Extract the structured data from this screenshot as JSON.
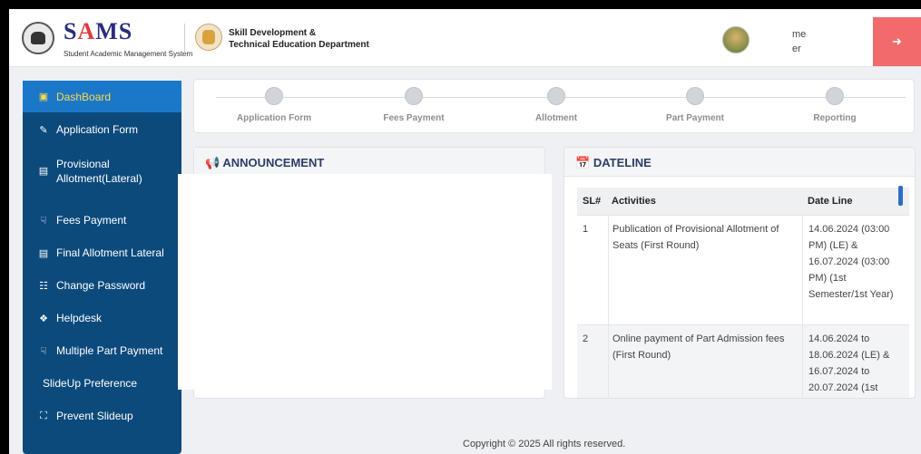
{
  "header": {
    "brand_title_s": "S",
    "brand_title_a": "A",
    "brand_title_ms": "MS",
    "brand_subtitle": "Student Academic Management System",
    "dept_line1": "Skill Development &",
    "dept_line2": "Technical Education Department",
    "user_name": "me",
    "user_role": "er"
  },
  "sidebar": {
    "items": [
      {
        "label": "DashBoard",
        "icon": "dashboard-icon"
      },
      {
        "label": "Application Form",
        "icon": "edit-icon"
      },
      {
        "label": "Provisional Allotment(Lateral)",
        "icon": "document-icon"
      },
      {
        "label": "Fees Payment",
        "icon": "hand-money-icon"
      },
      {
        "label": "Final Allotment Lateral",
        "icon": "document-icon"
      },
      {
        "label": "Change Password",
        "icon": "key-icon"
      },
      {
        "label": "Helpdesk",
        "icon": "support-icon"
      },
      {
        "label": "Multiple Part Payment",
        "icon": "hand-money-icon"
      },
      {
        "label": "SlideUp Preference",
        "icon": ""
      },
      {
        "label": "Prevent Slideup",
        "icon": "expand-icon"
      }
    ]
  },
  "steps": [
    "Application Form",
    "Fees Payment",
    "Allotment",
    "Part Payment",
    "Reporting"
  ],
  "announcement": {
    "title": "ANNOUNCEMENT"
  },
  "dateline": {
    "title": "DATELINE",
    "headers": [
      "SL#",
      "Activities",
      "Date Line"
    ],
    "rows": [
      {
        "sl": "1",
        "activity": "Publication of Provisional Allotment of Seats (First Round)",
        "date": "14.06.2024 (03:00 PM) (LE) & 16.07.2024 (03:00 PM) (1st Semester/1st Year)"
      },
      {
        "sl": "2",
        "activity": "Online payment of Part Admission fees (First Round)",
        "date": "14.06.2024 to 18.06.2024 (LE) & 16.07.2024 to 20.07.2024 (1st"
      }
    ]
  },
  "footer": "Copyright © 2025 All rights reserved.",
  "colors": {
    "sidebar": "#0c4a7c",
    "active": "#1b78c9",
    "logout": "#f26b6b"
  }
}
